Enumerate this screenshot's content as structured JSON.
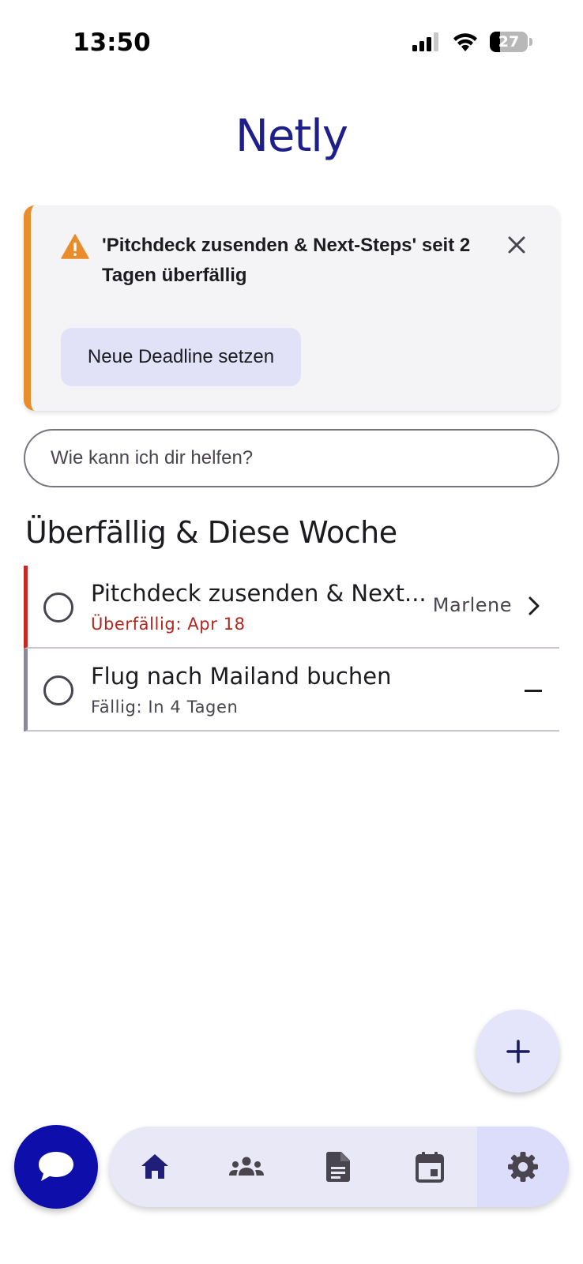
{
  "status_bar": {
    "time": "13:50",
    "battery_level": "27"
  },
  "header": {
    "title": "Netly"
  },
  "alert": {
    "message": "'Pitchdeck zusenden & Next-Steps' seit 2 Tagen überfällig",
    "button_label": "Neue Deadline setzen",
    "accent_color": "#e88c2c"
  },
  "search": {
    "placeholder": "Wie kann ich dir helfen?"
  },
  "section": {
    "title": "Überfällig & Diese Woche"
  },
  "tasks": [
    {
      "title": "Pitchdeck zusenden & Next...",
      "subtitle": "Überfällig: Apr 18",
      "assignee": "Marlene",
      "status": "overdue",
      "status_color": "#c62828"
    },
    {
      "title": "Flug nach Mailand buchen",
      "subtitle": "Fällig: In 4 Tagen",
      "assignee": "",
      "status": "due",
      "status_color": "#8a8a96"
    }
  ],
  "fab": {
    "icon": "plus-icon"
  },
  "chat": {
    "icon": "chat-bubble-icon",
    "color": "#0e0eab"
  },
  "bottom_nav": {
    "items": [
      {
        "icon": "home-icon",
        "active": true
      },
      {
        "icon": "people-icon",
        "active": false
      },
      {
        "icon": "document-icon",
        "active": false
      },
      {
        "icon": "calendar-icon",
        "active": false
      },
      {
        "icon": "settings-gear-icon",
        "active": false
      }
    ]
  }
}
